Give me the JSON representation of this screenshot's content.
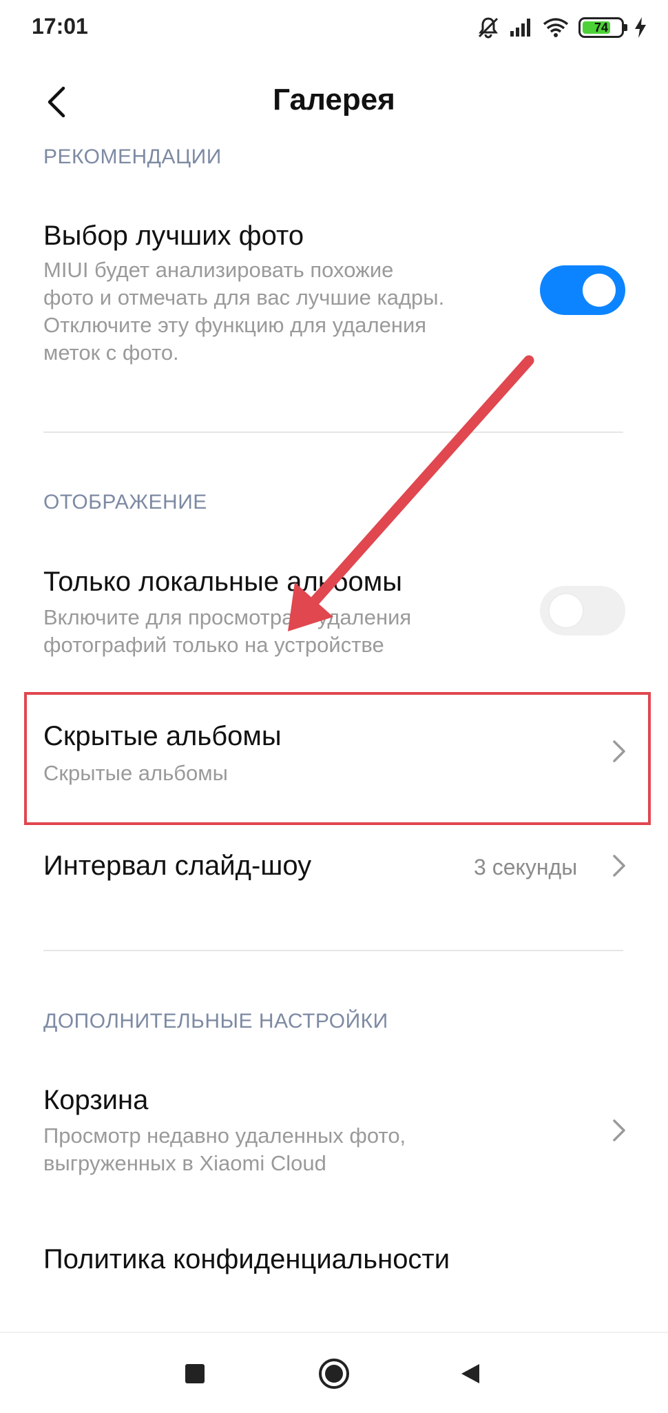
{
  "status_bar": {
    "time": "17:01",
    "battery_level": "74",
    "icons": [
      "muted-bell-icon",
      "signal-icon",
      "wifi-icon",
      "battery-icon",
      "charging-icon"
    ]
  },
  "header": {
    "title": "Галерея",
    "back_icon": "chevron-left-icon"
  },
  "sections": {
    "recommendations": {
      "header": "РЕКОМЕНДАЦИИ",
      "best_photos": {
        "title": "Выбор лучших фото",
        "desc_line1": "MIUI будет анализировать похожие",
        "desc_line2": "фото и отмечать для вас лучшие кадры.",
        "desc_line3": "Отключите эту функцию для удаления",
        "desc_line4": "меток с фото.",
        "enabled": true
      }
    },
    "display": {
      "header": "ОТОБРАЖЕНИЕ",
      "local_albums": {
        "title": "Только локальные альбомы",
        "desc_line1": "Включите для просмотра и удаления",
        "desc_line2": "фотографий только на устройстве",
        "enabled": false
      },
      "hidden_albums": {
        "title": "Скрытые альбомы",
        "desc": "Скрытые альбомы"
      },
      "slideshow": {
        "title": "Интервал слайд-шоу",
        "value": "3 секунды"
      }
    },
    "advanced": {
      "header": "ДОПОЛНИТЕЛЬНЫЕ НАСТРОЙКИ",
      "trash": {
        "title": "Корзина",
        "desc_line1": "Просмотр недавно удаленных фото,",
        "desc_line2": "выгруженных в Xiaomi Cloud"
      },
      "privacy": {
        "title": "Политика конфиденциальности"
      }
    }
  },
  "nav_bar": {
    "buttons": [
      "recent-apps-icon",
      "home-icon",
      "back-triangle-icon"
    ]
  },
  "colors": {
    "accent": "#0d84ff",
    "section_header": "#7d8aa3",
    "annotation": "#e0474f"
  }
}
